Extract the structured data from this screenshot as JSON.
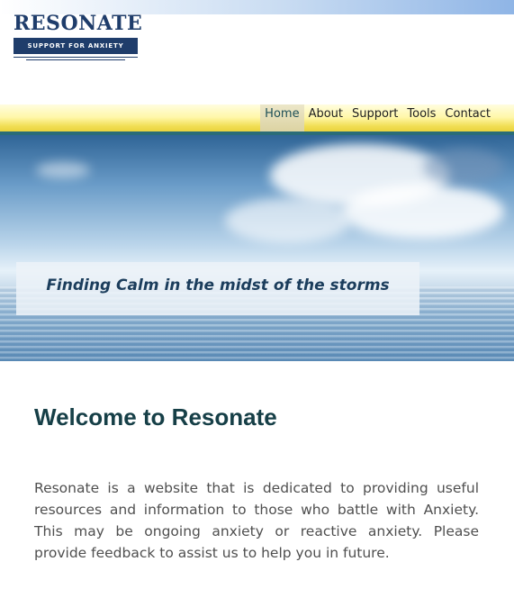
{
  "logo": {
    "title": "RESONATE",
    "tagline": "SUPPORT FOR ANXIETY"
  },
  "nav": {
    "items": [
      "Home",
      "About",
      "Support",
      "Tools",
      "Contact"
    ],
    "active": "Home"
  },
  "hero": {
    "caption": "Finding Calm in the midst of the storms"
  },
  "main": {
    "heading": "Welcome to Resonate",
    "paragraph": "Resonate is a website that is dedicated to providing useful resources and information to those who battle with Anxiety. This may be ongoing anxiety or reactive anxiety. Please provide feedback to assist us to help you in future."
  },
  "colors": {
    "brand": "#1f3d6b",
    "heading": "#163f47",
    "nav_band": "#f1de55",
    "nav_rule": "#2a6c78"
  }
}
